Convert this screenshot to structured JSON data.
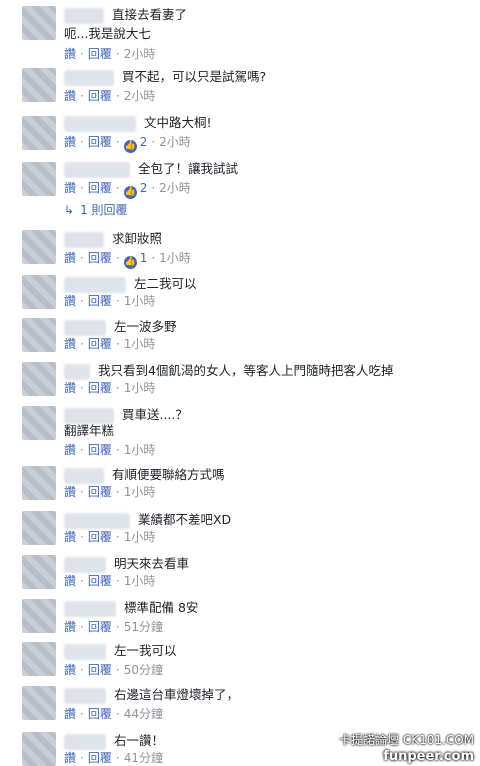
{
  "actions": {
    "like": "讚",
    "reply": "回覆",
    "dot": "·"
  },
  "comments": [
    {
      "text": "直接去看妻了",
      "text2": "呃...我是說大七",
      "time": "2小時"
    },
    {
      "text": "買不起，可以只是試駕嗎?",
      "time": "2小時"
    },
    {
      "text": "文中路大桐!",
      "likes": "2",
      "time": "2小時"
    },
    {
      "text": "全包了！讓我試試",
      "likes": "2",
      "time": "2小時"
    },
    {
      "text": "求卸妝照",
      "likes": "1",
      "time": "1小時"
    },
    {
      "text": "左二我可以",
      "time": "1小時"
    },
    {
      "text": "左一波多野",
      "time": "1小時"
    },
    {
      "text": "我只看到4個飢渴的女人，等客人上門隨時把客人吃掉",
      "time": "1小時"
    },
    {
      "text": "買車送....？",
      "text2": "翻譯年糕",
      "time": "1小時"
    },
    {
      "text": "有順便要聯絡方式嗎",
      "time": "1小時"
    },
    {
      "text": "業績都不差吧XD",
      "time": "1小時"
    },
    {
      "text": "明天來去看車",
      "time": "1小時"
    },
    {
      "text": "標準配備 8安",
      "time": "51分鐘"
    },
    {
      "text": "左一我可以",
      "time": "50分鐘"
    },
    {
      "text": "右邊這台車燈壞掉了，",
      "time": "44分鐘"
    },
    {
      "text": "右一讚！",
      "time": "41分鐘"
    }
  ],
  "replies_link": "1 則回覆",
  "watermark": {
    "line1": "卡提諾論壇 CK101.COM",
    "line2": "funpeer.com"
  },
  "colors": {
    "link": "#4267b2",
    "meta": "#90949c",
    "text": "#1d2129"
  }
}
